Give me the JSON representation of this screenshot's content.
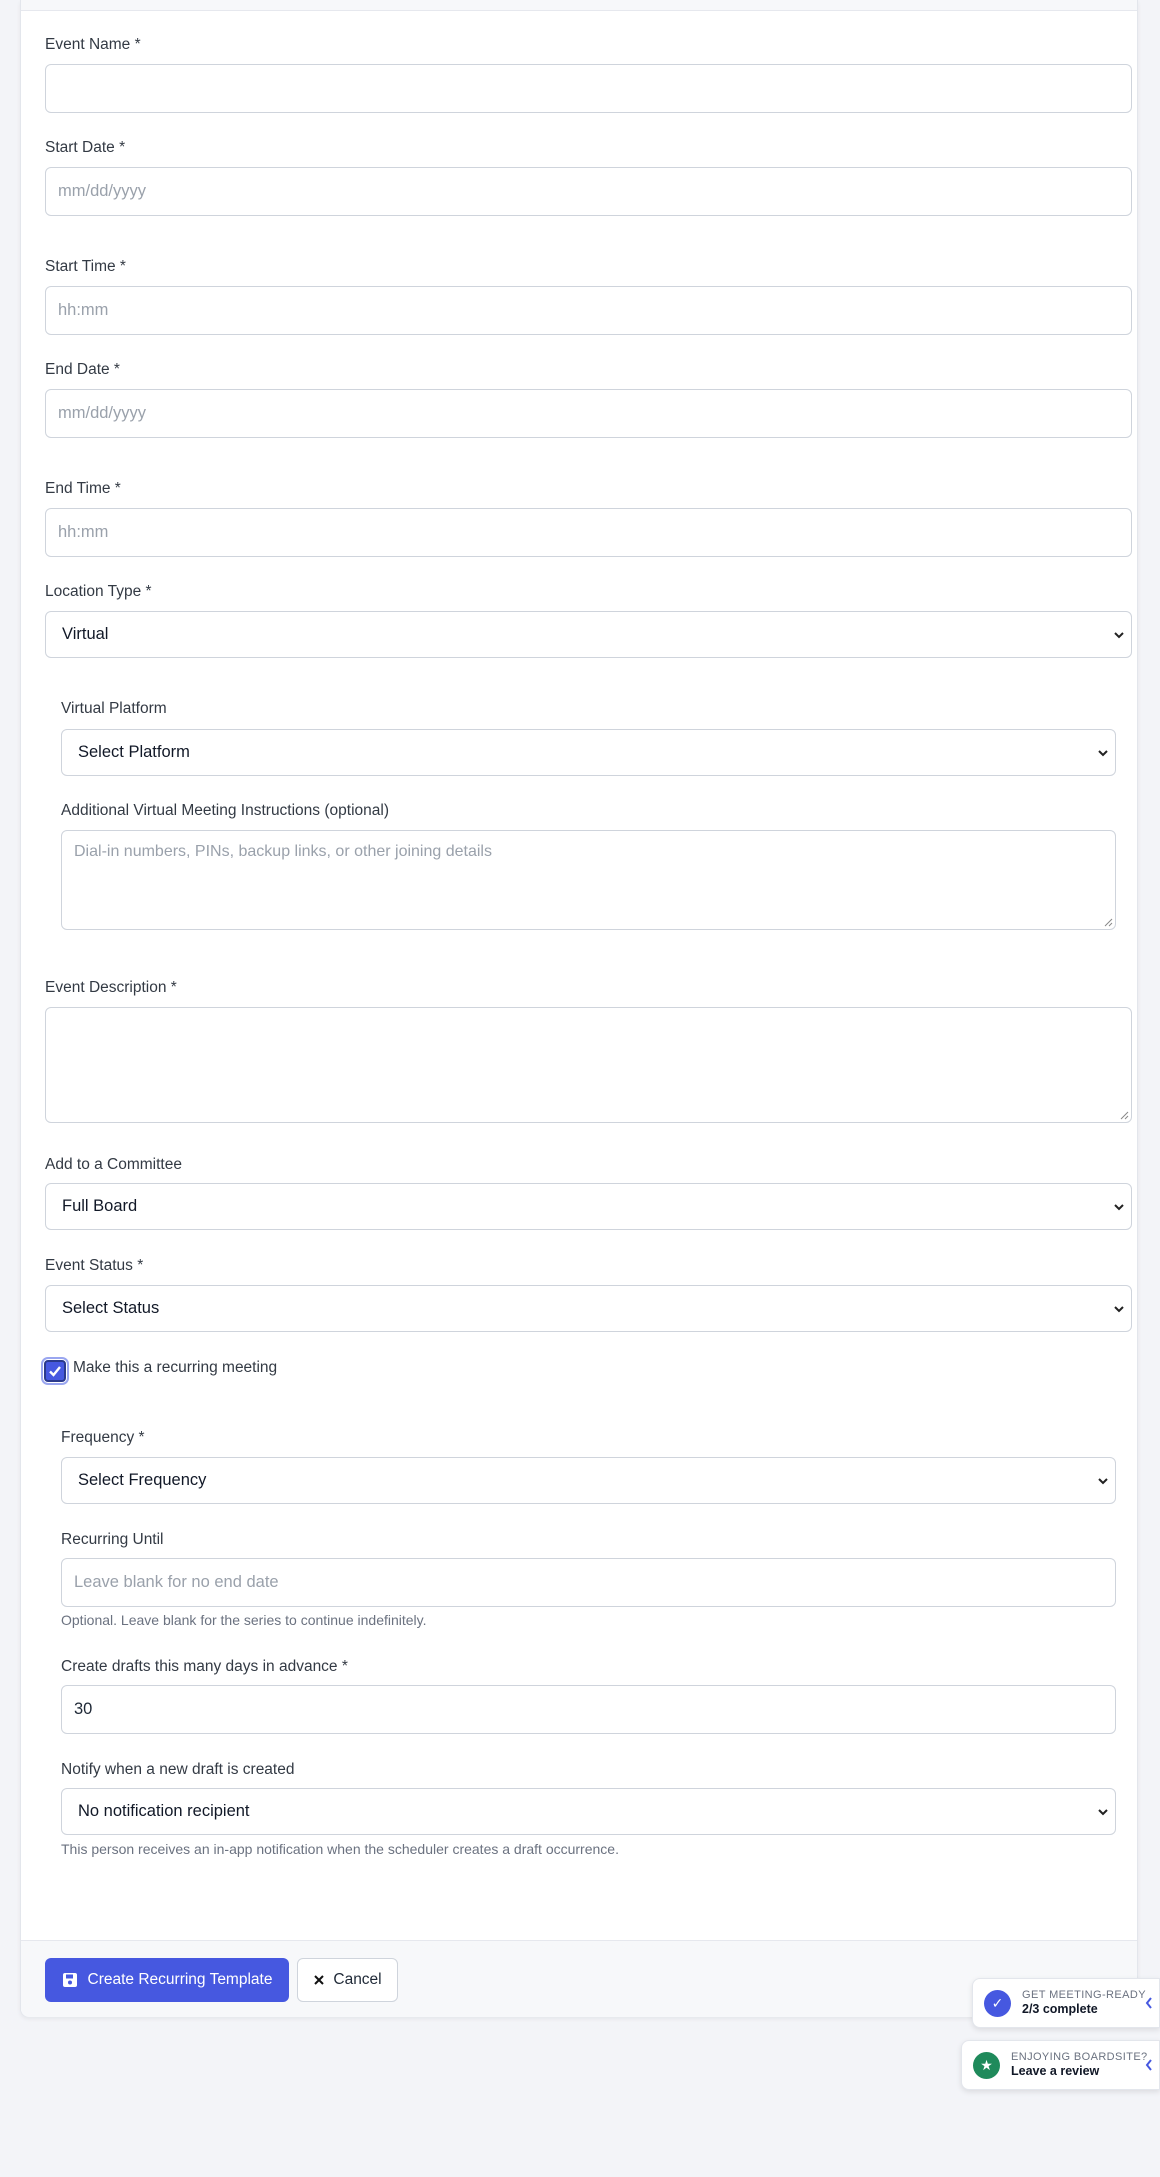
{
  "form": {
    "event_name": {
      "label": "Event Name *",
      "value": ""
    },
    "start_date": {
      "label": "Start Date *",
      "placeholder": "mm/dd/yyyy"
    },
    "start_time": {
      "label": "Start Time *",
      "placeholder": "hh:mm"
    },
    "end_date": {
      "label": "End Date *",
      "placeholder": "mm/dd/yyyy"
    },
    "end_time": {
      "label": "End Time *",
      "placeholder": "hh:mm"
    },
    "location_type": {
      "label": "Location Type *",
      "selected": "Virtual"
    },
    "virtual_platform": {
      "label": "Virtual Platform",
      "selected": "Select Platform"
    },
    "virtual_instructions": {
      "label": "Additional Virtual Meeting Instructions (optional)",
      "placeholder": "Dial-in numbers, PINs, backup links, or other joining details"
    },
    "event_description": {
      "label": "Event Description *",
      "value": ""
    },
    "committee": {
      "label": "Add to a Committee",
      "selected": "Full Board"
    },
    "event_status": {
      "label": "Event Status *",
      "selected": "Select Status"
    },
    "recurring": {
      "label": "Make this a recurring meeting",
      "checked": true
    },
    "frequency": {
      "label": "Frequency *",
      "selected": "Select Frequency"
    },
    "recurring_until": {
      "label": "Recurring Until",
      "placeholder": "Leave blank for no end date",
      "help": "Optional. Leave blank for the series to continue indefinitely."
    },
    "drafts_days": {
      "label": "Create drafts this many days in advance *",
      "value": "30"
    },
    "notify": {
      "label": "Notify when a new draft is created",
      "selected": "No notification recipient",
      "help": "This person receives an in-app notification when the scheduler creates a draft occurrence."
    }
  },
  "footer": {
    "create_label": "Create Recurring Template",
    "cancel_label": "Cancel"
  },
  "toasts": {
    "meeting_ready": {
      "small": "GET MEETING-READY",
      "big": "2/3 complete"
    },
    "review": {
      "small": "ENJOYING BOARDSITE?",
      "big": "Leave a review"
    }
  },
  "colors": {
    "primary": "#4658e0",
    "review_badge": "#1f8a5b"
  }
}
